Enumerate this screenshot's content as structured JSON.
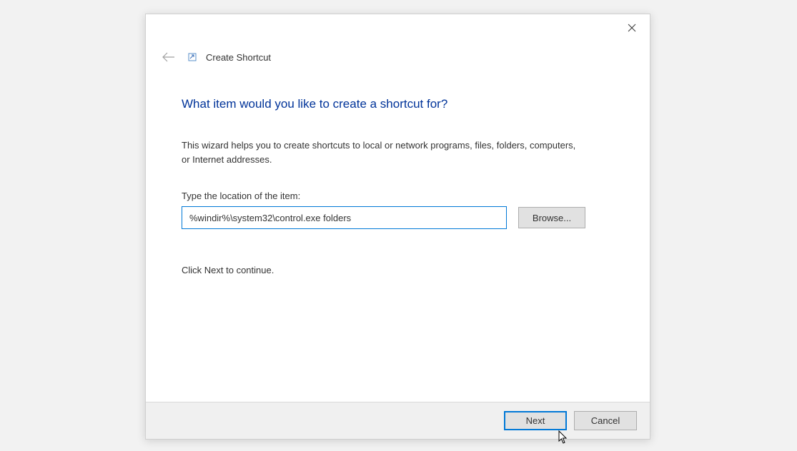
{
  "window": {
    "title": "Create Shortcut"
  },
  "content": {
    "heading": "What item would you like to create a shortcut for?",
    "description": "This wizard helps you to create shortcuts to local or network programs, files, folders, computers, or Internet addresses.",
    "field_label": "Type the location of the item:",
    "location_value": "%windir%\\system32\\control.exe folders",
    "browse_label": "Browse...",
    "hint": "Click Next to continue."
  },
  "footer": {
    "next_label": "Next",
    "cancel_label": "Cancel"
  }
}
